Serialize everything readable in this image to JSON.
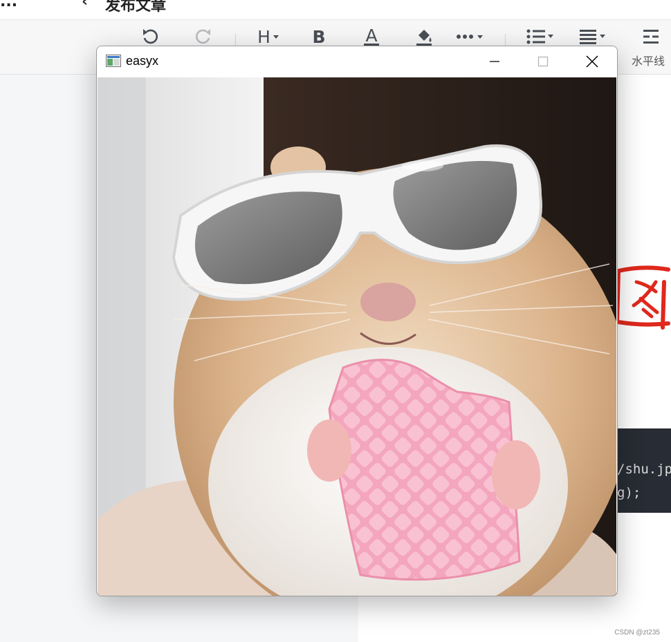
{
  "editor": {
    "crumb_left": "...",
    "crumb_right": "发布文章",
    "toolbar": {
      "items": [
        {
          "icon": "undo-icon"
        },
        {
          "icon": "redo-icon"
        },
        {
          "icon": "heading-icon",
          "glyph": "H"
        },
        {
          "icon": "bold-icon",
          "glyph": "B"
        },
        {
          "icon": "font-color-icon",
          "glyph": "A"
        },
        {
          "icon": "fill-color-icon"
        },
        {
          "icon": "more-icon"
        },
        {
          "icon": "unordered-list-icon"
        },
        {
          "icon": "align-icon"
        },
        {
          "icon": "horizontal-rule-icon"
        }
      ],
      "horizontal_rule_label": "水平线"
    },
    "code_lines": [
      "/shu.jp",
      "g);"
    ],
    "sketch_text": "图"
  },
  "window": {
    "title": "easyx",
    "controls": {
      "minimize": "minimize",
      "maximize": "maximize",
      "close": "close"
    },
    "image_description": "hamster-with-sunglasses-eating-wafer"
  },
  "watermark": "CSDN @zt235"
}
